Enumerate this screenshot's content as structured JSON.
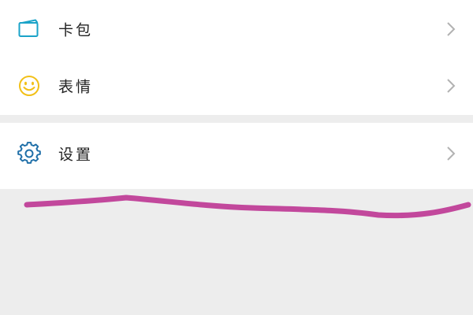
{
  "menu": {
    "group1": [
      {
        "label": "卡包",
        "icon": "card-wallet-icon"
      },
      {
        "label": "表情",
        "icon": "smiley-face-icon"
      }
    ],
    "group2": [
      {
        "label": "设置",
        "icon": "gear-icon"
      }
    ]
  },
  "colors": {
    "background": "#ededed",
    "row_background": "#ffffff",
    "label_text": "#222222",
    "chevron": "#b2b2b2",
    "card_icon": "#1aa3c8",
    "smiley_icon": "#f2c018",
    "gear_icon": "#1f6fa8",
    "annotation_stroke": "#c2489c"
  },
  "annotation": {
    "type": "freehand-underline-stroke"
  }
}
